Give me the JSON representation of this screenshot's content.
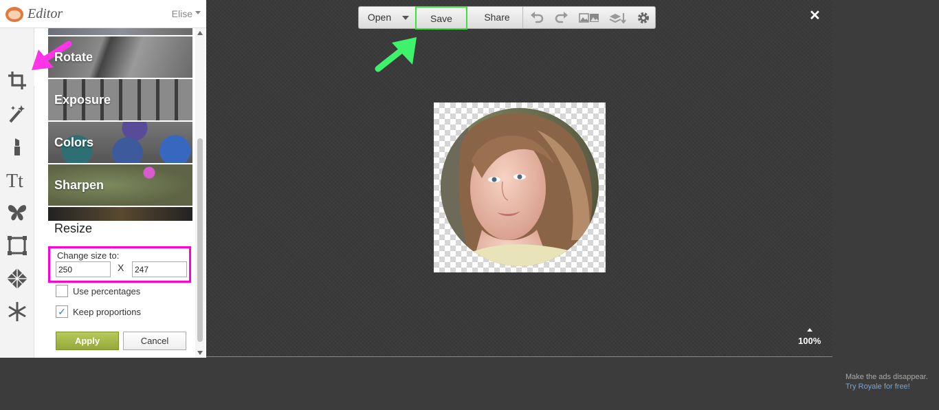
{
  "app": {
    "title": "Editor",
    "user": "Elise"
  },
  "rail": {
    "tools": [
      "crop-tool-icon",
      "effects-wand-icon",
      "touchup-lipstick-icon",
      "text-icon",
      "overlay-butterfly-icon",
      "frame-icon",
      "texture-icon",
      "seasonal-snowflake-icon"
    ]
  },
  "panel": {
    "effects": [
      "Rotate",
      "Exposure",
      "Colors",
      "Sharpen"
    ],
    "resize_title": "Resize",
    "change_size_label": "Change size to:",
    "width_value": "250",
    "height_value": "247",
    "times_sign": "X",
    "use_percentages_label": "Use percentages",
    "use_percentages_checked": false,
    "keep_proportions_label": "Keep proportions",
    "keep_proportions_checked": true,
    "keep_proportions_mark": "✓",
    "apply_label": "Apply",
    "cancel_label": "Cancel"
  },
  "toolbar": {
    "open_label": "Open",
    "save_label": "Save",
    "share_label": "Share"
  },
  "canvas": {
    "close_symbol": "✕",
    "zoom": "100%"
  },
  "ads": {
    "text": "Make the ads disappear.",
    "link": "Try Royale for free!"
  },
  "colors": {
    "highlight_pink": "#ff00dd",
    "highlight_green": "#3ee03e",
    "apply_green": "#a3b84a"
  }
}
